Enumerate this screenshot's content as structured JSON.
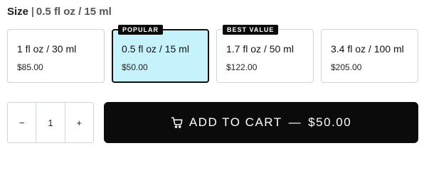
{
  "size": {
    "label": "Size",
    "separator": "|",
    "selected_value": "0.5 fl oz / 15 ml"
  },
  "options": [
    {
      "label": "1 fl oz / 30 ml",
      "price": "$85.00",
      "badge": "",
      "selected": false
    },
    {
      "label": "0.5 fl oz / 15 ml",
      "price": "$50.00",
      "badge": "POPULAR",
      "selected": true
    },
    {
      "label": "1.7 fl oz / 50 ml",
      "price": "$122.00",
      "badge": "BEST VALUE",
      "selected": false
    },
    {
      "label": "3.4 fl oz / 100 ml",
      "price": "$205.00",
      "badge": "",
      "selected": false
    }
  ],
  "quantity": {
    "decrement_label": "−",
    "value": "1",
    "increment_label": "+"
  },
  "add_to_cart": {
    "icon": "cart-icon",
    "label": "ADD TO CART",
    "dash": "—",
    "price": "$50.00"
  },
  "colors": {
    "selected_bg": "#c6f2fb",
    "button_bg": "#0b0b0b",
    "border": "#cfd4d6"
  }
}
